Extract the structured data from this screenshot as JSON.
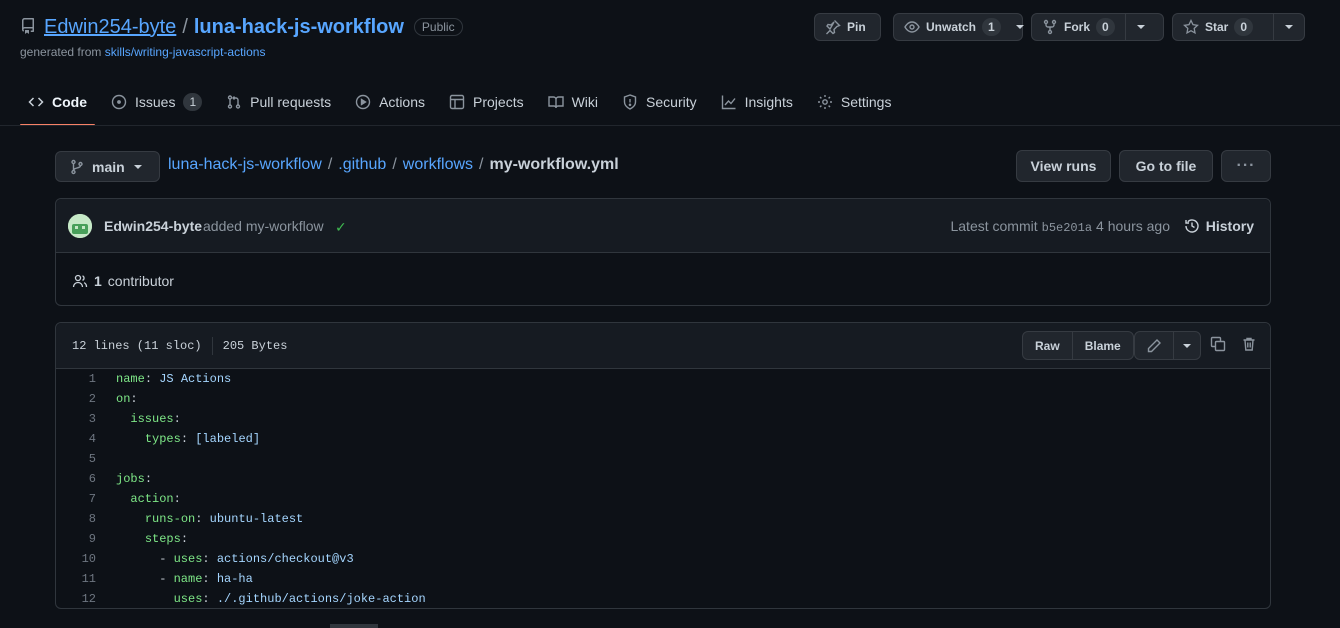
{
  "repo": {
    "owner": "Edwin254-byte",
    "separator": "/",
    "name": "luna-hack-js-workflow",
    "visibility": "Public",
    "generated_prefix": "generated from",
    "generated_link": "skills/writing-javascript-actions"
  },
  "header_buttons": {
    "pin": "Pin",
    "unwatch": "Unwatch",
    "unwatch_count": "1",
    "fork": "Fork",
    "fork_count": "0",
    "star": "Star",
    "star_count": "0"
  },
  "tabs": [
    {
      "label": "Code",
      "icon": "code-icon",
      "active": true
    },
    {
      "label": "Issues",
      "icon": "issue-icon",
      "count": "1"
    },
    {
      "label": "Pull requests",
      "icon": "pull-request-icon"
    },
    {
      "label": "Actions",
      "icon": "play-icon"
    },
    {
      "label": "Projects",
      "icon": "table-icon"
    },
    {
      "label": "Wiki",
      "icon": "book-icon"
    },
    {
      "label": "Security",
      "icon": "shield-icon"
    },
    {
      "label": "Insights",
      "icon": "graph-icon"
    },
    {
      "label": "Settings",
      "icon": "gear-icon"
    }
  ],
  "breadcrumb": {
    "branch": "main",
    "repo": "luna-hack-js-workflow",
    "dir1": ".github",
    "dir2": "workflows",
    "file": "my-workflow.yml",
    "sep": "/"
  },
  "actions": {
    "view_runs": "View runs",
    "go_to_file": "Go to file",
    "more": "···"
  },
  "commit": {
    "author": "Edwin254-byte",
    "message": "added my-workflow",
    "status": "✓",
    "latest_label": "Latest commit",
    "sha": "b5e201a",
    "time": "4 hours ago",
    "history": "History",
    "contrib_count": "1",
    "contrib_label": "contributor"
  },
  "file": {
    "lines_info": "12 lines (11 sloc)",
    "size": "205 Bytes",
    "raw": "Raw",
    "blame": "Blame"
  },
  "code_lines": [
    {
      "n": "1",
      "indent": "",
      "key": "name",
      "sep": ": ",
      "value": "JS Actions"
    },
    {
      "n": "2",
      "indent": "",
      "key": "on",
      "sep": ":",
      "value": ""
    },
    {
      "n": "3",
      "indent": "  ",
      "key": "issues",
      "sep": ":",
      "value": ""
    },
    {
      "n": "4",
      "indent": "    ",
      "key": "types",
      "sep": ": ",
      "value": "[labeled]"
    },
    {
      "n": "5",
      "indent": "",
      "key": "",
      "sep": "",
      "value": ""
    },
    {
      "n": "6",
      "indent": "",
      "key": "jobs",
      "sep": ":",
      "value": ""
    },
    {
      "n": "7",
      "indent": "  ",
      "key": "action",
      "sep": ":",
      "value": ""
    },
    {
      "n": "8",
      "indent": "    ",
      "key": "runs-on",
      "sep": ": ",
      "value": "ubuntu-latest"
    },
    {
      "n": "9",
      "indent": "    ",
      "key": "steps",
      "sep": ":",
      "value": ""
    },
    {
      "n": "10",
      "indent": "      - ",
      "key": "uses",
      "sep": ": ",
      "value": "actions/checkout@v3"
    },
    {
      "n": "11",
      "indent": "      - ",
      "key": "name",
      "sep": ": ",
      "value": "ha-ha"
    },
    {
      "n": "12",
      "indent": "        ",
      "key": "uses",
      "sep": ": ",
      "value": "./.github/actions/joke-action"
    }
  ],
  "colors": {
    "background": "#0d1117",
    "accent": "#58a6ff",
    "active_tab_underline": "#f78166",
    "yaml_key": "#7ee787",
    "yaml_value": "#a5d6ff",
    "success": "#3fb950"
  }
}
